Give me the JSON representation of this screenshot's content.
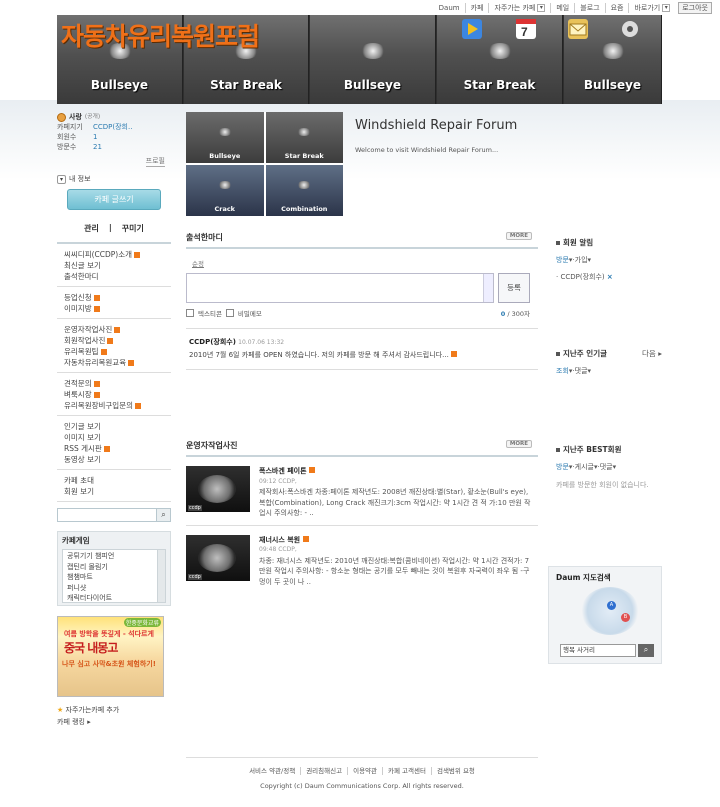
{
  "topbar": {
    "items": [
      "Daum",
      "카페",
      "자주가는 카페",
      "메일",
      "블로그",
      "요즘",
      "바로가기"
    ],
    "logout": "로그아웃"
  },
  "banner": {
    "title": "자동차유리복원포럼",
    "tiles": [
      "Bullseye",
      "Star Break",
      "Bullseye",
      "Star Break",
      "Bullseye"
    ]
  },
  "profile": {
    "name": "사랑",
    "visibility": "(공개)",
    "labels": {
      "manager": "카페지기",
      "members": "회원수",
      "visitors": "방문수"
    },
    "manager": "CCDP(장희..",
    "members": "1",
    "visitors": "21",
    "promo": "프로필",
    "myinfo": "내 정보",
    "write_button": "카페 글쓰기",
    "manage": "관리",
    "decorate": "꾸미기"
  },
  "menu": {
    "groups": [
      [
        {
          "label": "씨씨디피(CCDP)소개",
          "new": true
        },
        {
          "label": "최신글 보기",
          "new": false
        },
        {
          "label": "출석한마디",
          "new": false
        }
      ],
      [
        {
          "label": "등업신청",
          "new": true
        },
        {
          "label": "이미지방",
          "new": true
        }
      ],
      [
        {
          "label": "운영자작업사진",
          "new": true
        },
        {
          "label": "회원작업사진",
          "new": true
        },
        {
          "label": "유리복원팁",
          "new": true
        },
        {
          "label": "자동차유리복원교육",
          "new": true
        }
      ],
      [
        {
          "label": "견적문의",
          "new": true
        },
        {
          "label": "벼룩시장",
          "new": true
        },
        {
          "label": "유리복원장비구입문의",
          "new": true
        }
      ],
      [
        {
          "label": "인기글 보기",
          "new": false
        },
        {
          "label": "이미지 보기",
          "new": false
        },
        {
          "label": "RSS 게시판",
          "new": true
        },
        {
          "label": "동영상 보기",
          "new": false
        }
      ],
      [
        {
          "label": "카페 초대",
          "new": false
        },
        {
          "label": "회원 보기",
          "new": false
        }
      ]
    ]
  },
  "games": {
    "title": "카페게임",
    "items": [
      "공튀기기 챔피언",
      "캡틴리 몰림기",
      "챔챔마트",
      "퍼니샷",
      "캐릭터다이어트"
    ]
  },
  "ad": {
    "tag": "한중문화교류",
    "line1": "여름 방학을 뜻깊게 - 석다르게",
    "line2": "중국 내몽고",
    "line3": "나무 심고 사막&초원 체험하기!"
  },
  "fav": {
    "add": "자주가는카페 추가",
    "ranking": "카페 랭킹"
  },
  "hero": {
    "grid_labels": [
      "Bullseye",
      "Star Break",
      "Crack",
      "Combination"
    ],
    "title": "Windshield Repair Forum",
    "welcome": "Welcome to visit Windshield Repair Forum..."
  },
  "attendance": {
    "title": "출석한마디",
    "more": "MORE",
    "sort": "순정",
    "register": "등록",
    "opt1": "텍스티콘",
    "opt2": "비밀메모",
    "count": "0",
    "limit": " / 300자",
    "comment": {
      "author": "CCDP(장희수)",
      "time": "10.07.06 13:32",
      "text": "2010년 7월 6일 카페를 OPEN 하였습니다. 저의 카페를 방문 해 주셔서 감사드립니다..."
    }
  },
  "photos": {
    "title": "운영자작업사진",
    "more": "MORE",
    "items": [
      {
        "title": "폭스바겐 페이톤",
        "meta": "09:12 CCDP,",
        "text": "제작회사:폭스바겐 차종:페이톤 제작년도: 2008년 깨진상태:별(Star), 황소눈(Bull's eye), 복합(Combination), Long Crack 깨진크기:3cm 작업시간: 약 1시간 견 적 가:10 만원 작업시 주의사항: - ..",
        "thumb": "ccdp"
      },
      {
        "title": "재너시스 복원",
        "meta": "09:48 CCDP,",
        "text": "차종: 재너시스 제작년도: 2010년 깨진상태:복합(콤비네이션) 작업시간: 약 1시간 견적가: 7 만원 작업시 주의사항: - 항소눈 형태는 공기를 모두 빼내는 것이 복원후 자국력이 좌우 됨 -구멍이 두 곳이 나 ..",
        "thumb": "ccdp"
      }
    ]
  },
  "right": {
    "members": {
      "title": "회원 알림",
      "tab1": "방문",
      "tab2": "가입",
      "item": "CCDP(장희수)"
    },
    "popular": {
      "title": "지난주 인기글",
      "next": "다음",
      "tab1": "조회",
      "tab2": "댓글"
    },
    "best": {
      "title": "지난주 BEST회원",
      "tab1": "방문",
      "tab2": "게시글",
      "tab3": "댓글",
      "note": "카페를 방문한 회원이 없습니다."
    }
  },
  "map": {
    "title": "Daum 지도검색",
    "value": "행복 사거리"
  },
  "footer": {
    "links": [
      "서비스 약관/정책",
      "권리침해신고",
      "이용약관",
      "카페 고객센터",
      "검색범위 요청"
    ],
    "copyright": "Copyright (c) Daum Communications Corp. All rights reserved."
  }
}
